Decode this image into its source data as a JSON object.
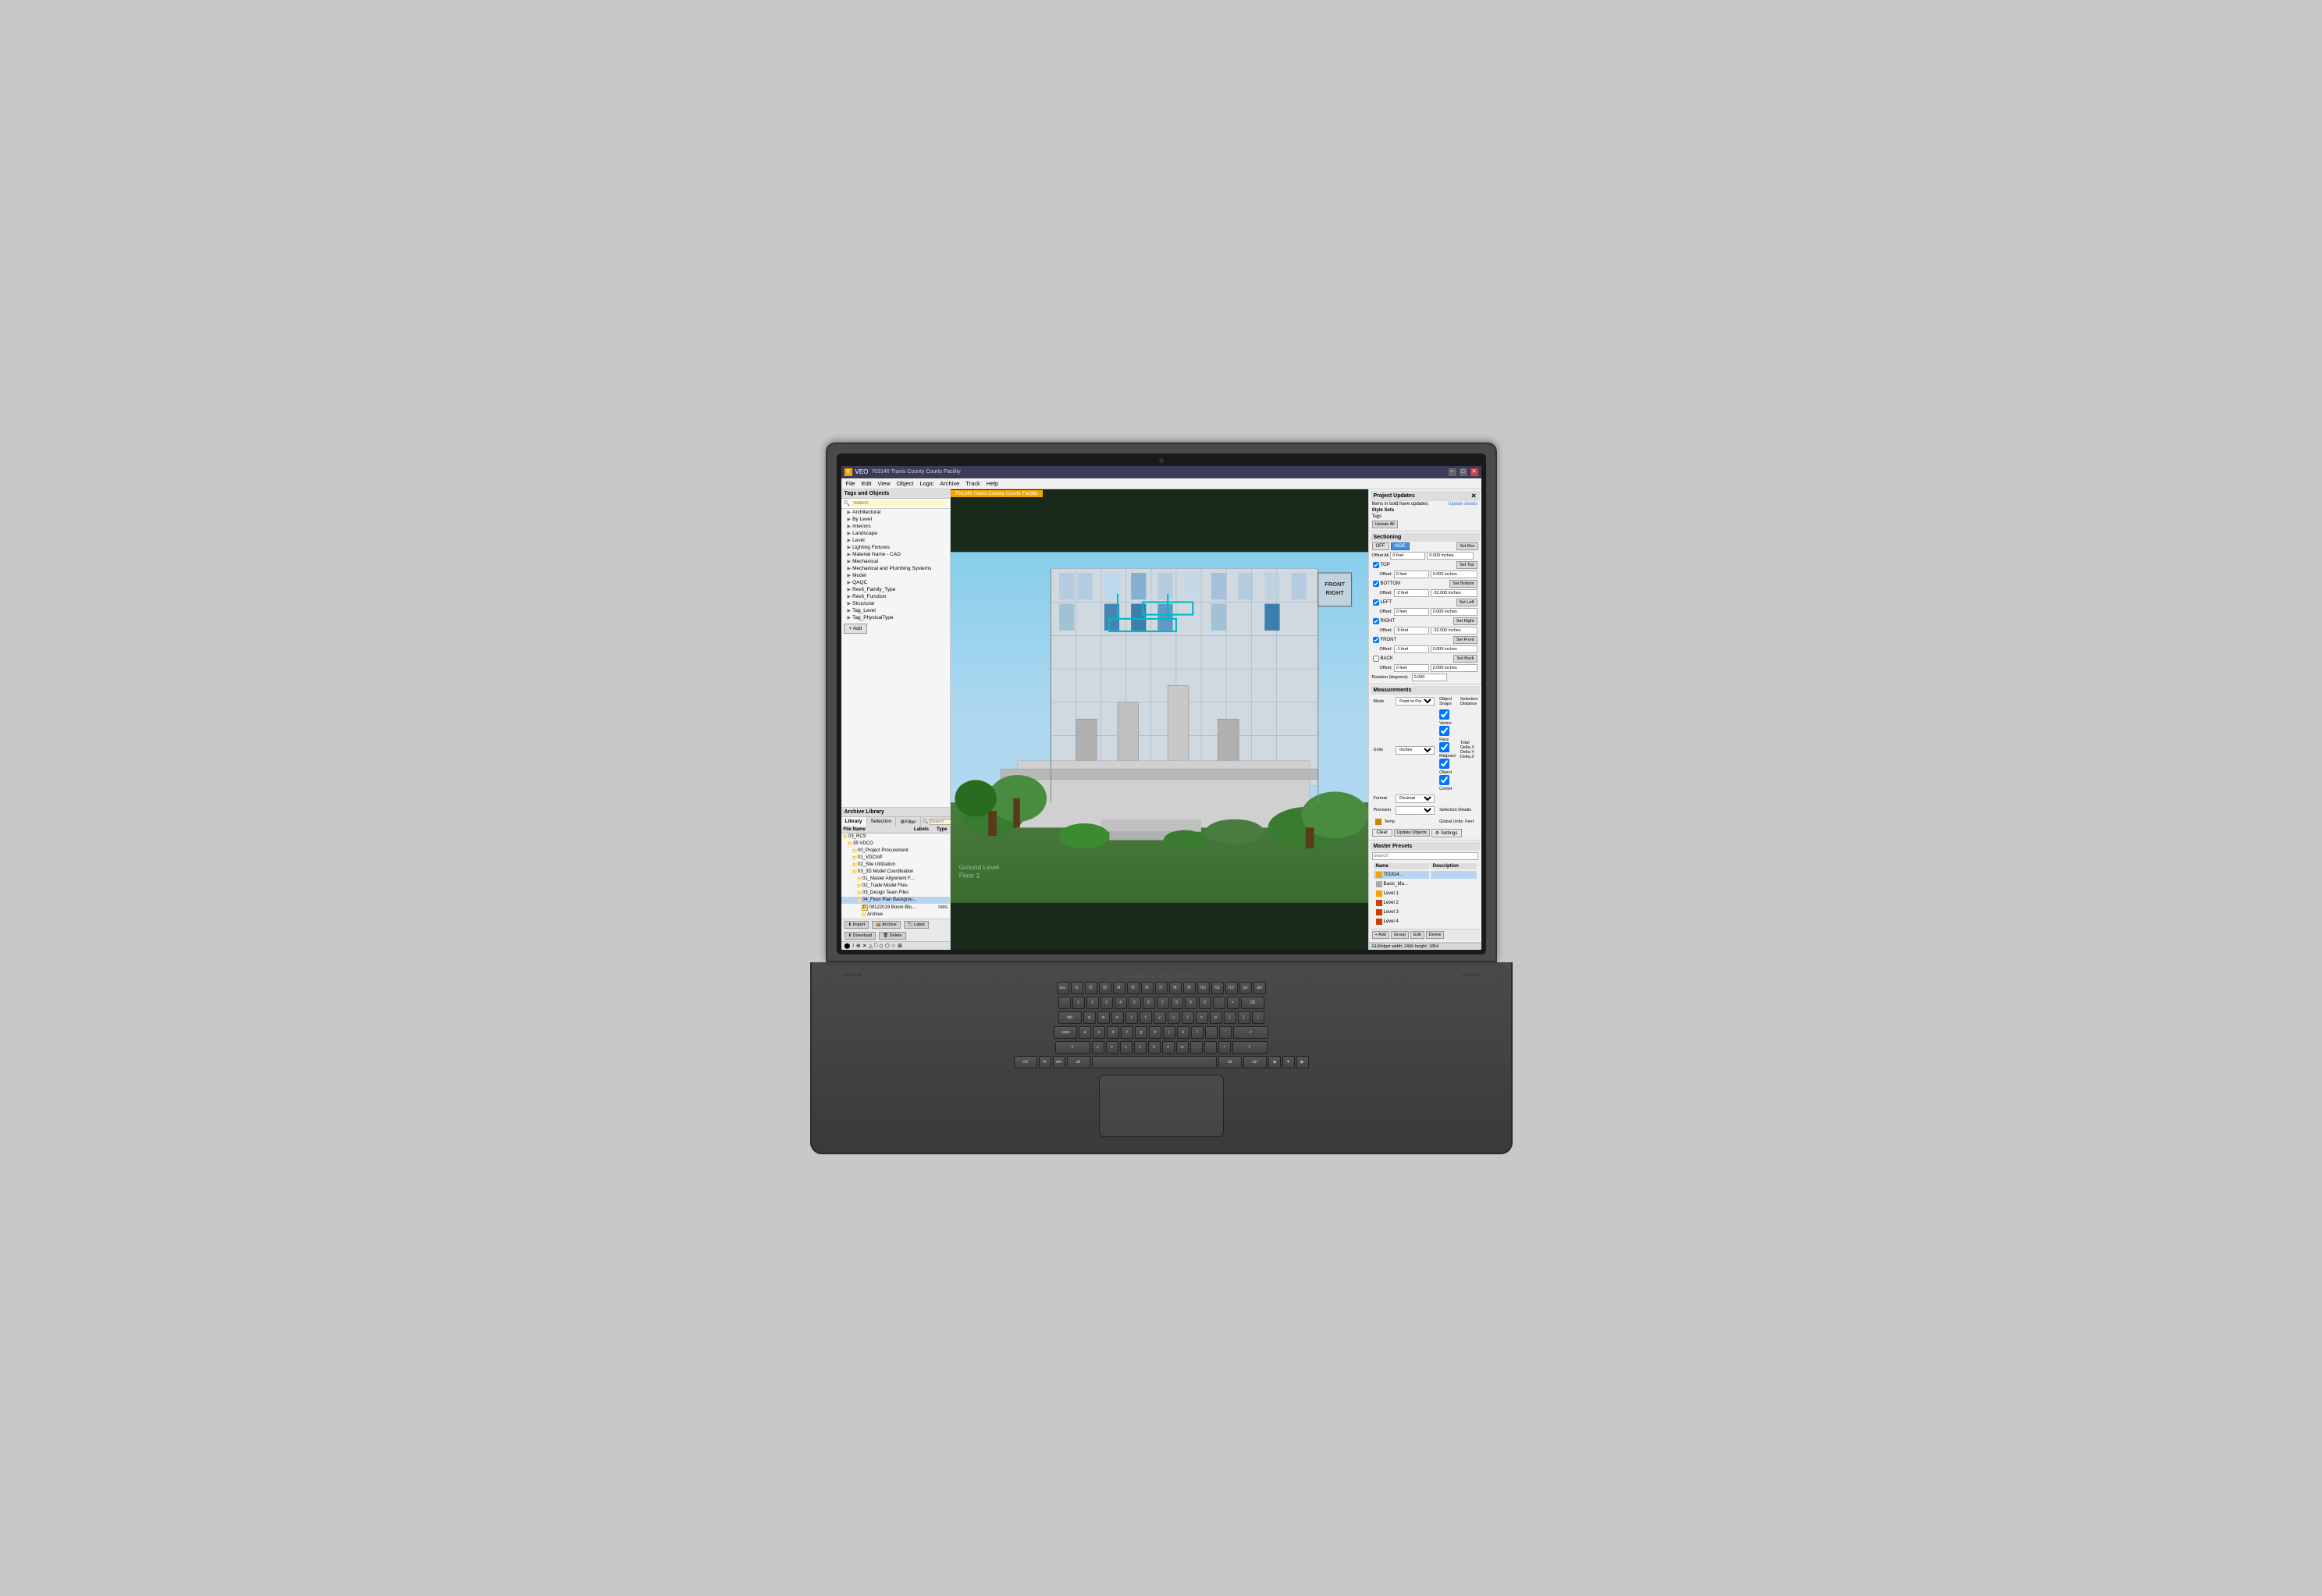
{
  "app": {
    "title": "VEO",
    "window_tab": "703146 Travis County Courts Facility"
  },
  "menu": {
    "items": [
      "File",
      "Edit",
      "View",
      "Object",
      "Logic",
      "Archive",
      "Track",
      "Help"
    ]
  },
  "left_panel": {
    "title": "Tags and Objects",
    "search_placeholder": "Search",
    "tree_items": [
      "Architectural",
      "By Level",
      "Interiors",
      "Landscape",
      "Level",
      "Lighting Fixtures",
      "Material Name - CAD",
      "Mechanical",
      "Mechanical and Plumbing Systems",
      "Model",
      "QAQC",
      "Revit_Family_Type",
      "Revit_Function",
      "Structural",
      "Tag_Level",
      "Tag_PhysicalType"
    ],
    "add_label": "+ Add",
    "archive_library": {
      "title": "Archive Library",
      "tabs": [
        "Library",
        "Selection",
        "Filter"
      ],
      "search_placeholder": "Search",
      "columns": [
        "File Name",
        "Labels",
        "Type"
      ],
      "files": [
        {
          "name": "03_RCS",
          "type": "folder",
          "level": 0
        },
        {
          "name": "35 VDCO",
          "type": "folder",
          "level": 1
        },
        {
          "name": "00_Project Procurement",
          "type": "folder",
          "level": 2
        },
        {
          "name": "01_VDCInP",
          "type": "folder",
          "level": 2
        },
        {
          "name": "02_Site Utilization",
          "type": "folder",
          "level": 2
        },
        {
          "name": "03_3D Model Coordination",
          "type": "folder",
          "level": 2
        },
        {
          "name": "01_Master Alignment F...",
          "type": "folder",
          "level": 3
        },
        {
          "name": "02_Trade Model Files",
          "type": "folder",
          "level": 3
        },
        {
          "name": "03_Design Team Files",
          "type": "folder",
          "level": 3
        },
        {
          "name": "04_Floor Plan Backgrou...",
          "type": "folder",
          "level": 3,
          "selected": true
        },
        {
          "name": "09122019 Boom Blo...",
          "type": "DWG",
          "level": 4,
          "label": "DWG"
        },
        {
          "name": "Archive",
          "type": "folder",
          "level": 4
        }
      ]
    },
    "bottom_toolbar": [
      "Import",
      "Archive",
      "Label",
      "Download",
      "Delete"
    ]
  },
  "viewport": {
    "tab_label": "703146 Travis County Courts Facility"
  },
  "right_panel": {
    "project_updates": {
      "title": "Project Updates",
      "subtitle": "Items in bold have updates:",
      "update_details_label": "Update details",
      "style_sets_label": "Style Sets",
      "tags_label": "Tags"
    },
    "sectioning": {
      "title": "Sectioning",
      "off_label": "OFF",
      "hide_label": "HIDE",
      "set_box_label": "Set Box",
      "planes": [
        {
          "name": "TOP",
          "checked": true,
          "offset_label": "Offset:",
          "offset_val": "0 feet",
          "measurement": "0.000 inches",
          "set_label": "Set Top"
        },
        {
          "name": "BOTTOM",
          "checked": true,
          "offset_label": "Offset:",
          "offset_val": "-2 feet",
          "measurement": "-32.000 inches",
          "set_label": "Set Bottom"
        },
        {
          "name": "LEFT",
          "checked": true,
          "offset_label": "Offset:",
          "offset_val": "0 feet",
          "measurement": "0.000 inches",
          "set_label": "Set Left"
        },
        {
          "name": "RIGHT",
          "checked": true,
          "offset_label": "Offset:",
          "offset_val": "-5 feet",
          "measurement": "-32.000 inches",
          "set_label": "Set Right"
        },
        {
          "name": "FRONT",
          "checked": true,
          "offset_label": "Offset:",
          "offset_val": "-1 feet",
          "measurement": "0.000 inches",
          "set_label": "Set Front"
        },
        {
          "name": "BACK",
          "checked": false,
          "offset_label": "Offset:",
          "offset_val": "0 feet",
          "measurement": "0.000 inches",
          "set_label": "Set Back"
        }
      ],
      "rotation_label": "Rotation (degrees):",
      "rotation_val": "0.000"
    },
    "measurements": {
      "title": "Measurements",
      "mode_label": "Mode",
      "mode_val": "Point to Point",
      "units_label": "Units",
      "units_val": "Inches",
      "format_label": "Format",
      "format_val": "Decimal",
      "precision_label": "Precision",
      "object_snaps": {
        "label": "Object Snaps",
        "vertex": "Vertex",
        "midpoint": "Midpoint",
        "face": "Face",
        "object": "Object",
        "center": "Center"
      },
      "selection_distance": {
        "label": "Selection Distance",
        "total": "Total",
        "delta_x": "Delta X",
        "delta_y": "Delta Y",
        "delta_z": "Delta Z"
      },
      "selection_details_label": "Selection Details",
      "global_units": "Global Units: Feet",
      "temp_label": "Temp"
    },
    "actions": {
      "clear_label": "Clear",
      "update_objects_label": "Update Objects",
      "settings_label": "Settings"
    },
    "master_presets": {
      "title": "Master Presets",
      "search_placeholder": "Search",
      "columns": [
        "Name",
        "Description"
      ],
      "items": [
        {
          "name": "701814...",
          "description": "",
          "type": "file",
          "color": "#f0a500",
          "selected": true
        },
        {
          "name": "Basic_Ma...",
          "description": "",
          "type": "file",
          "color": "#aaa"
        },
        {
          "name": "Level 1",
          "type": "folder",
          "color": "#f0a500"
        },
        {
          "name": "Level 2",
          "type": "folder",
          "color": "#d04000"
        },
        {
          "name": "Level 3",
          "type": "folder",
          "color": "#d04000"
        },
        {
          "name": "Level 4",
          "type": "folder",
          "color": "#d04000"
        }
      ],
      "toolbar": [
        "Add",
        "Group",
        "Edit",
        "Delete"
      ]
    },
    "status_bar": "GLWidget width: 2406  height: 1854"
  },
  "keyboard": {
    "rows": [
      [
        "esc",
        "f1",
        "f2",
        "f3",
        "f4",
        "f5",
        "f6",
        "f7",
        "f8",
        "f9",
        "f10",
        "f11",
        "f12",
        "prt",
        "del"
      ],
      [
        "`",
        "1",
        "2",
        "3",
        "4",
        "5",
        "6",
        "7",
        "8",
        "9",
        "0",
        "-",
        "=",
        "⌫"
      ],
      [
        "tab",
        "q",
        "w",
        "e",
        "r",
        "t",
        "y",
        "u",
        "i",
        "o",
        "p",
        "[",
        "]",
        "\\"
      ],
      [
        "caps",
        "a",
        "s",
        "d",
        "f",
        "g",
        "h",
        "j",
        "k",
        "l",
        ";",
        "'",
        "↵"
      ],
      [
        "⇧",
        "z",
        "x",
        "c",
        "v",
        "b",
        "n",
        "m",
        ",",
        ".",
        "/",
        "⇧"
      ],
      [
        "ctrl",
        "fn",
        "win",
        "alt",
        "",
        "alt",
        "ctrl",
        "◀",
        "▼",
        "▶"
      ]
    ]
  },
  "hp_logo": "hp"
}
